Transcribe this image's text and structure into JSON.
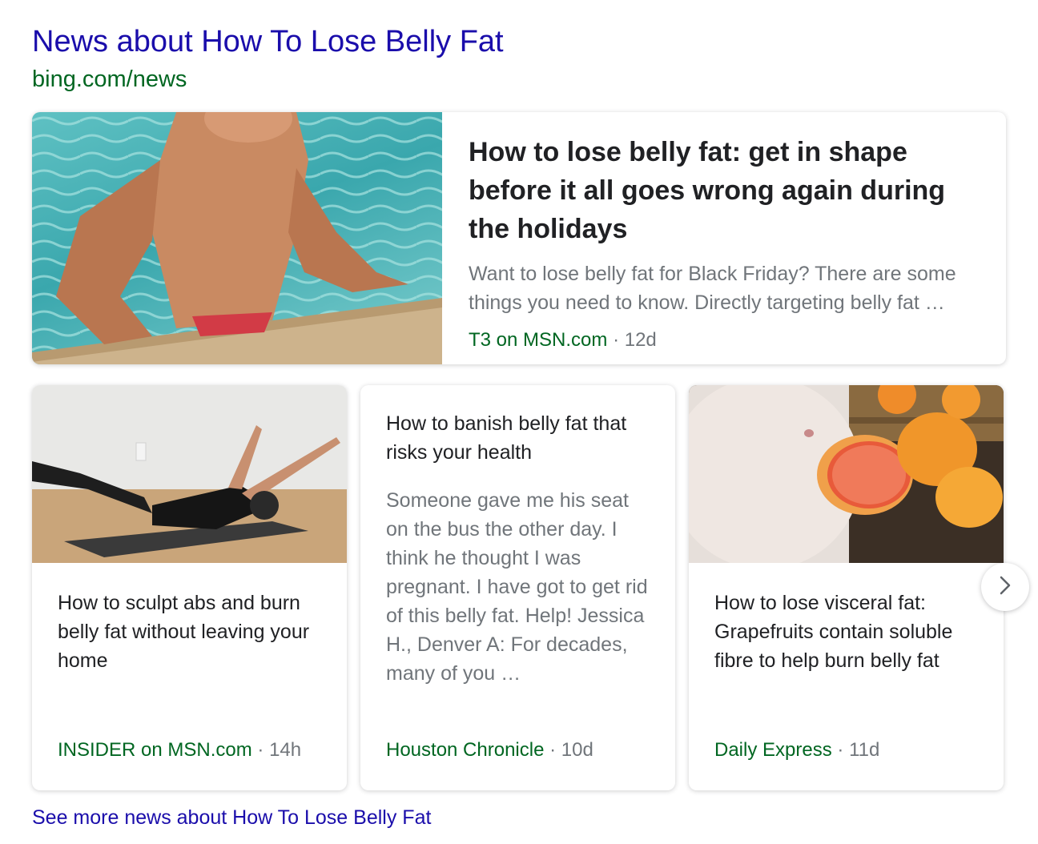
{
  "header": {
    "title": "News about How To Lose Belly Fat",
    "url": "bing.com/news"
  },
  "featured": {
    "title": "How to lose belly fat: get in shape before it all goes wrong again during the holidays",
    "snippet": "Want to lose belly fat for Black Friday? There are some things you need to know. Directly targeting belly fat …",
    "publisher": "T3 on MSN.com",
    "separator": "·",
    "age": "12d"
  },
  "cards": [
    {
      "title": "How to sculpt abs and burn belly fat without leaving your home",
      "publisher": "INSIDER on MSN.com",
      "separator": "·",
      "age": "14h"
    },
    {
      "title": "How to banish belly fat that risks your health",
      "snippet": "Someone gave me his seat on the bus the other day. I think he thought I was pregnant. I have got to get rid of this belly fat. Help! Jessica H., Denver A: For decades, many of you …",
      "publisher": "Houston Chronicle",
      "separator": "·",
      "age": "10d"
    },
    {
      "title": "How to lose visceral fat: Grapefruits contain soluble fibre to help burn belly fat",
      "publisher": "Daily Express",
      "separator": "·",
      "age": "11d"
    }
  ],
  "next_icon": "chevron-right-icon",
  "see_more": "See more news about How To Lose Belly Fat",
  "colors": {
    "link": "#1a0dab",
    "url_green": "#006621",
    "muted": "#70757a",
    "title": "#202124"
  }
}
